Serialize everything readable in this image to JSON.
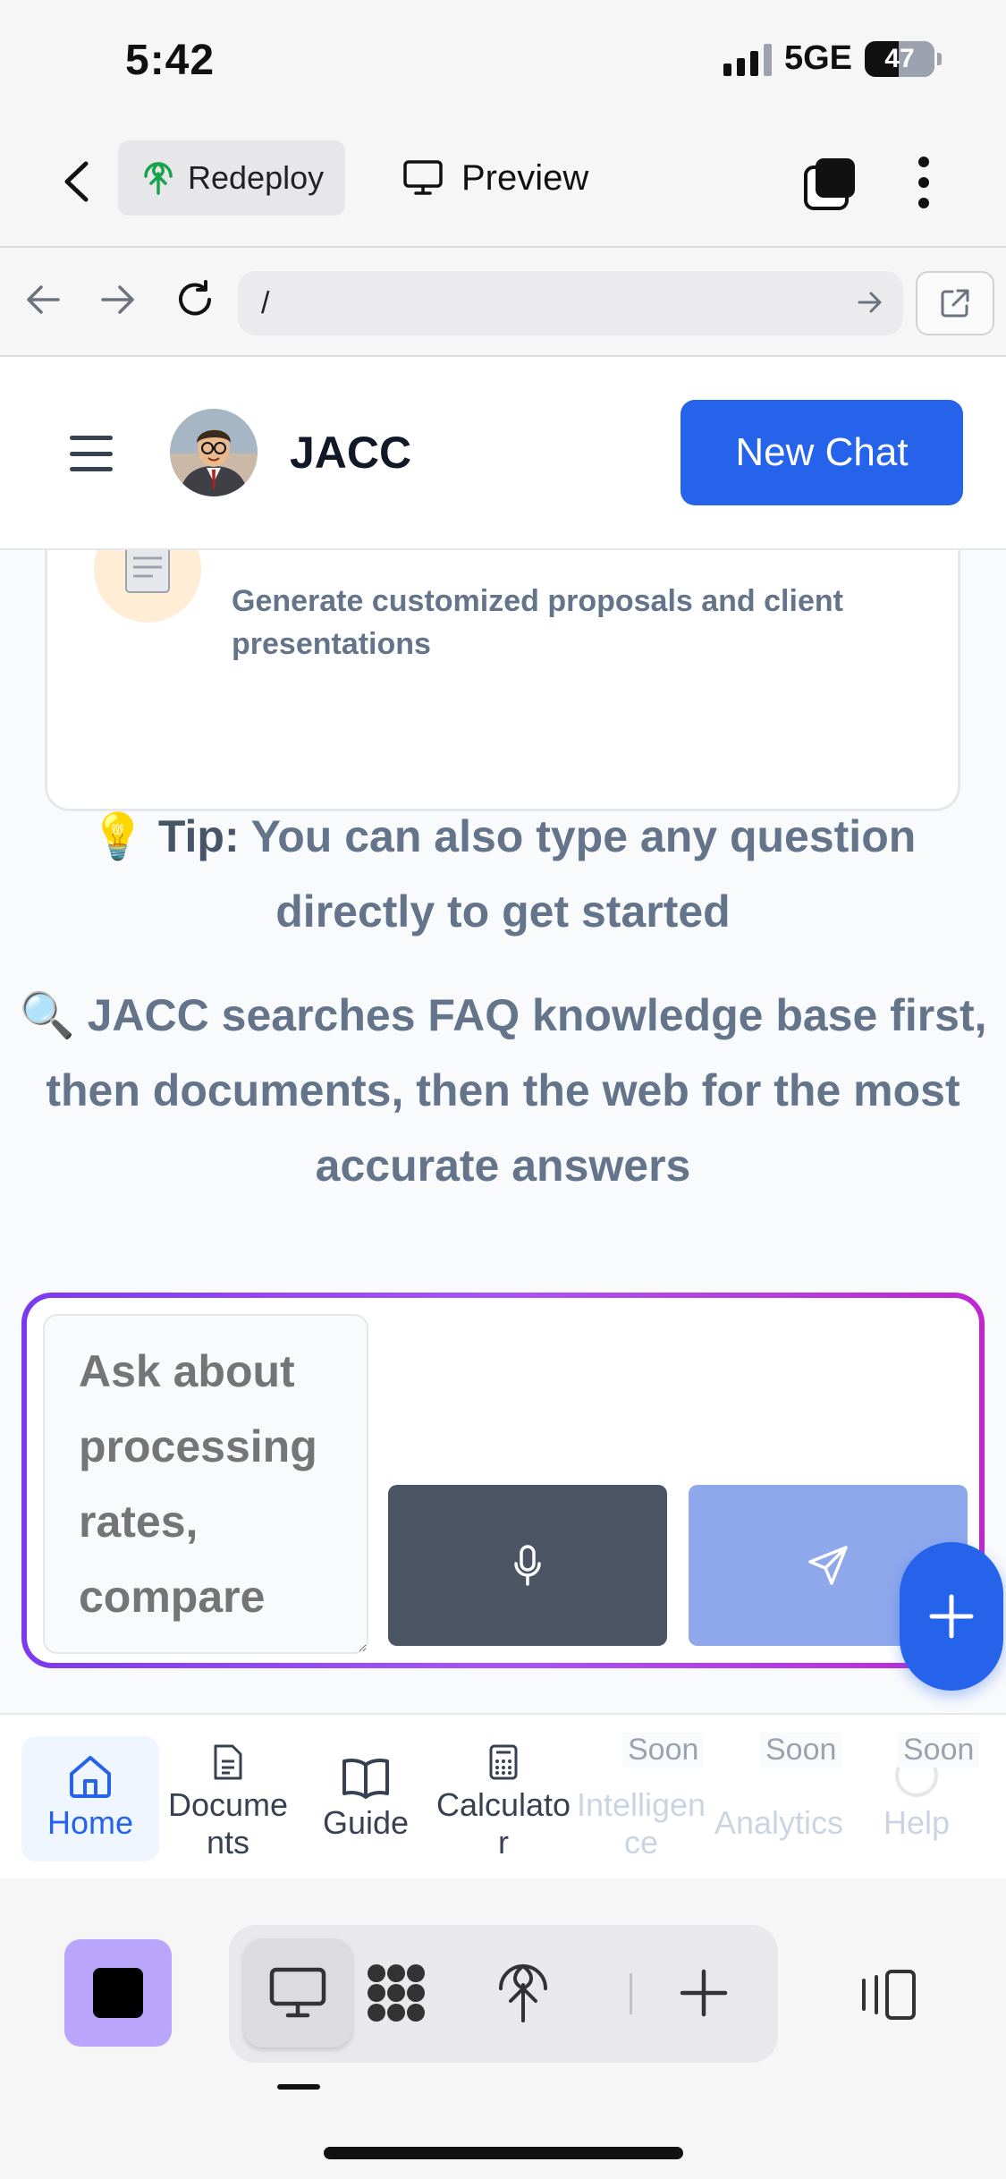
{
  "status_bar": {
    "time": "5:42",
    "network": "5GE",
    "battery": "47"
  },
  "replit_topbar": {
    "redeploy_label": "Redeploy",
    "preview_label": "Preview"
  },
  "url_bar": {
    "url": "/"
  },
  "app_header": {
    "title": "JACC",
    "new_chat_label": "New Chat"
  },
  "content": {
    "card_description": "Generate customized proposals and client presentations",
    "tip_emoji": "💡",
    "tip_label": "Tip:",
    "tip_text": "You can also type any question directly to get started",
    "search_emoji": "🔍",
    "search_text": "JACC searches FAQ knowledge base first, then documents, then the web for the most accurate answers"
  },
  "composer": {
    "placeholder": "Ask about processing rates, compare"
  },
  "bottom_nav": {
    "items": [
      {
        "label": "Home",
        "active": true
      },
      {
        "label": "Documents"
      },
      {
        "label": "Guide"
      },
      {
        "label": "Calculator"
      },
      {
        "label": "Intelligence",
        "badge": "Soon"
      },
      {
        "label": "Analytics",
        "badge": "Soon"
      },
      {
        "label": "Help",
        "badge": "Soon"
      }
    ]
  },
  "colors": {
    "primary": "#2563eb",
    "composer_gradient_start": "#7c3aed",
    "composer_gradient_end": "#c026d3"
  }
}
